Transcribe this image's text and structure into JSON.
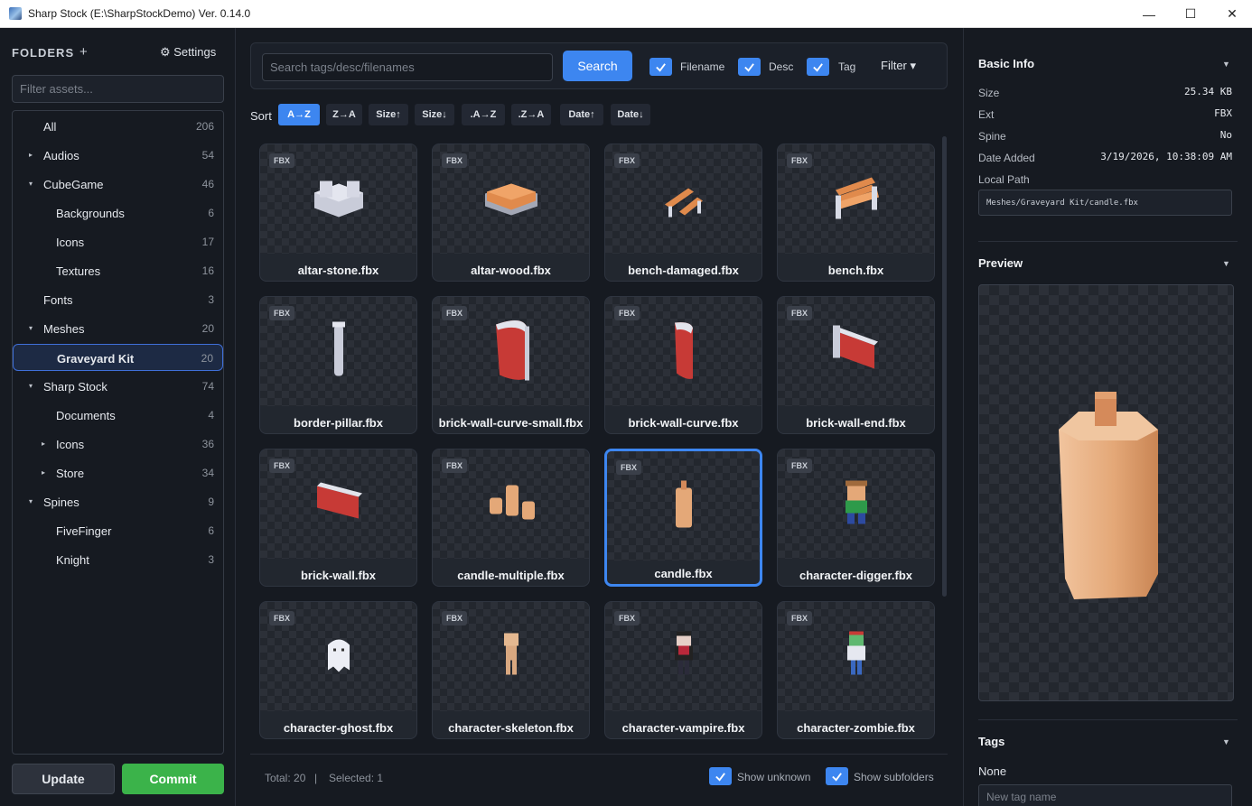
{
  "window": {
    "title": "Sharp Stock (E:\\SharpStockDemo) Ver. 0.14.0",
    "minimize": "—",
    "maximize": "☐",
    "close": "✕"
  },
  "sidebar": {
    "header": "FOLDERS",
    "add_icon": "+",
    "settings_label": "⚙ Settings",
    "filter_placeholder": "Filter assets...",
    "tree": [
      {
        "label": "All",
        "count": "206",
        "depth": 0,
        "caret": ""
      },
      {
        "label": "Audios",
        "count": "54",
        "depth": 0,
        "caret": "▸"
      },
      {
        "label": "CubeGame",
        "count": "46",
        "depth": 0,
        "caret": "▾"
      },
      {
        "label": "Backgrounds",
        "count": "6",
        "depth": 1,
        "caret": ""
      },
      {
        "label": "Icons",
        "count": "17",
        "depth": 1,
        "caret": ""
      },
      {
        "label": "Textures",
        "count": "16",
        "depth": 1,
        "caret": ""
      },
      {
        "label": "Fonts",
        "count": "3",
        "depth": 0,
        "caret": ""
      },
      {
        "label": "Meshes",
        "count": "20",
        "depth": 0,
        "caret": "▾"
      },
      {
        "label": "Graveyard Kit",
        "count": "20",
        "depth": 1,
        "caret": "",
        "selected": true
      },
      {
        "label": "Sharp Stock",
        "count": "74",
        "depth": 0,
        "caret": "▾"
      },
      {
        "label": "Documents",
        "count": "4",
        "depth": 1,
        "caret": ""
      },
      {
        "label": "Icons",
        "count": "36",
        "depth": 1,
        "caret": "▸"
      },
      {
        "label": "Store",
        "count": "34",
        "depth": 1,
        "caret": "▸"
      },
      {
        "label": "Spines",
        "count": "9",
        "depth": 0,
        "caret": "▾"
      },
      {
        "label": "FiveFinger",
        "count": "6",
        "depth": 1,
        "caret": ""
      },
      {
        "label": "Knight",
        "count": "3",
        "depth": 1,
        "caret": ""
      }
    ],
    "update_label": "Update",
    "commit_label": "Commit",
    "commit_color": "#3bb34a"
  },
  "search": {
    "placeholder": "Search tags/desc/filenames",
    "button_label": "Search",
    "checks": [
      {
        "label": "Filename",
        "checked": true
      },
      {
        "label": "Desc",
        "checked": true
      },
      {
        "label": "Tag",
        "checked": true
      }
    ],
    "filter_label": "Filter ▾",
    "accent": "#3d86f0"
  },
  "sort": {
    "label": "Sort",
    "options": [
      "A→Z",
      "Z→A",
      "Size↑",
      "Size↓",
      ".A→Z",
      ".Z→A",
      "Date↑",
      "Date↓"
    ],
    "active": "A→Z"
  },
  "assets": [
    {
      "name": "altar-stone.fbx",
      "badge": "FBX",
      "icon": "altar-stone-icon"
    },
    {
      "name": "altar-wood.fbx",
      "badge": "FBX",
      "icon": "altar-wood-icon"
    },
    {
      "name": "bench-damaged.fbx",
      "badge": "FBX",
      "icon": "bench-damaged-icon"
    },
    {
      "name": "bench.fbx",
      "badge": "FBX",
      "icon": "bench-icon"
    },
    {
      "name": "border-pillar.fbx",
      "badge": "FBX",
      "icon": "pillar-icon"
    },
    {
      "name": "brick-wall-curve-small.fbx",
      "badge": "FBX",
      "icon": "brick-wall-curve-small-icon"
    },
    {
      "name": "brick-wall-curve.fbx",
      "badge": "FBX",
      "icon": "brick-wall-curve-icon"
    },
    {
      "name": "brick-wall-end.fbx",
      "badge": "FBX",
      "icon": "brick-wall-end-icon"
    },
    {
      "name": "brick-wall.fbx",
      "badge": "FBX",
      "icon": "brick-wall-icon"
    },
    {
      "name": "candle-multiple.fbx",
      "badge": "FBX",
      "icon": "candles-icon"
    },
    {
      "name": "candle.fbx",
      "badge": "FBX",
      "icon": "candle-icon",
      "selected": true
    },
    {
      "name": "character-digger.fbx",
      "badge": "FBX",
      "icon": "digger-icon"
    },
    {
      "name": "character-ghost.fbx",
      "badge": "FBX",
      "icon": "ghost-icon"
    },
    {
      "name": "character-skeleton.fbx",
      "badge": "FBX",
      "icon": "skeleton-icon"
    },
    {
      "name": "character-vampire.fbx",
      "badge": "FBX",
      "icon": "vampire-icon"
    },
    {
      "name": "character-zombie.fbx",
      "badge": "FBX",
      "icon": "zombie-icon"
    }
  ],
  "footer": {
    "total": "Total: 20",
    "sep": "|",
    "selected": "Selected: 1",
    "show_unknown": "Show unknown",
    "show_subfolders": "Show subfolders"
  },
  "info": {
    "title": "Basic Info",
    "chevron": "▼",
    "rows": [
      {
        "key": "Size",
        "value": "25.34 KB"
      },
      {
        "key": "Ext",
        "value": "FBX"
      },
      {
        "key": "Spine",
        "value": "No"
      },
      {
        "key": "Date Added",
        "value": "3/19/2026, 10:38:09 AM"
      }
    ],
    "path_label": "Local Path",
    "path_value": "Meshes/Graveyard Kit/candle.fbx"
  },
  "preview": {
    "title": "Preview",
    "chevron": "▼"
  },
  "tags": {
    "title": "Tags",
    "chevron": "▼",
    "none_label": "None",
    "placeholder": "New tag name"
  }
}
